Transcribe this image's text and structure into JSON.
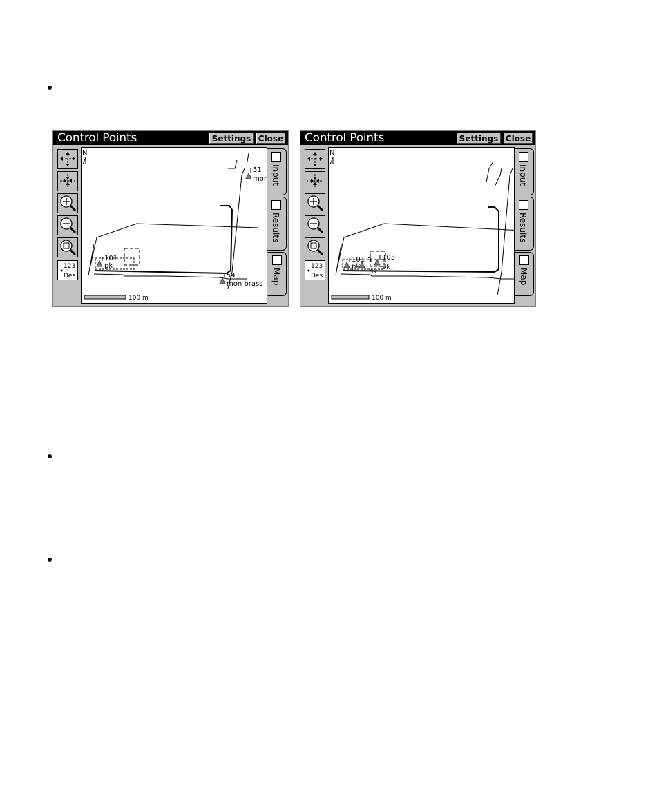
{
  "screens": [
    {
      "title": "Control Points",
      "settings_label": "Settings",
      "close_label": "Close",
      "tabs": [
        {
          "label": "Input"
        },
        {
          "label": "Results"
        },
        {
          "label": "Map"
        }
      ],
      "active_tab": "Map",
      "tools": [
        {
          "icon": "zoom-extents-icon"
        },
        {
          "icon": "zoom-center-icon"
        },
        {
          "icon": "zoom-in-icon"
        },
        {
          "icon": "zoom-out-icon"
        },
        {
          "icon": "zoom-window-icon"
        },
        {
          "icon": "point-labels-icon",
          "label_top": "123",
          "label_bottom": "Des"
        }
      ],
      "north_label": "N",
      "scale_label": "100 m",
      "labels": {
        "p1": "101",
        "p1_desc": "pk",
        "p2": "51",
        "p2_desc": "mon",
        "p3": "54",
        "p3_desc": "mon brass"
      }
    },
    {
      "title": "Control Points",
      "settings_label": "Settings",
      "close_label": "Close",
      "tabs": [
        {
          "label": "Input"
        },
        {
          "label": "Results"
        },
        {
          "label": "Map"
        }
      ],
      "active_tab": "Map",
      "tools": [
        {
          "icon": "zoom-extents-icon"
        },
        {
          "icon": "zoom-center-icon"
        },
        {
          "icon": "zoom-in-icon"
        },
        {
          "icon": "zoom-out-icon"
        },
        {
          "icon": "zoom-window-icon"
        },
        {
          "icon": "point-labels-icon",
          "label_top": "123",
          "label_bottom": "Des"
        }
      ],
      "north_label": "N",
      "scale_label": "100 m",
      "labels": {
        "p1": "101",
        "p1_desc": "pk",
        "p2": "3",
        "p3": "103",
        "p3_desc": "pk",
        "p4_desc": "pk"
      }
    }
  ]
}
